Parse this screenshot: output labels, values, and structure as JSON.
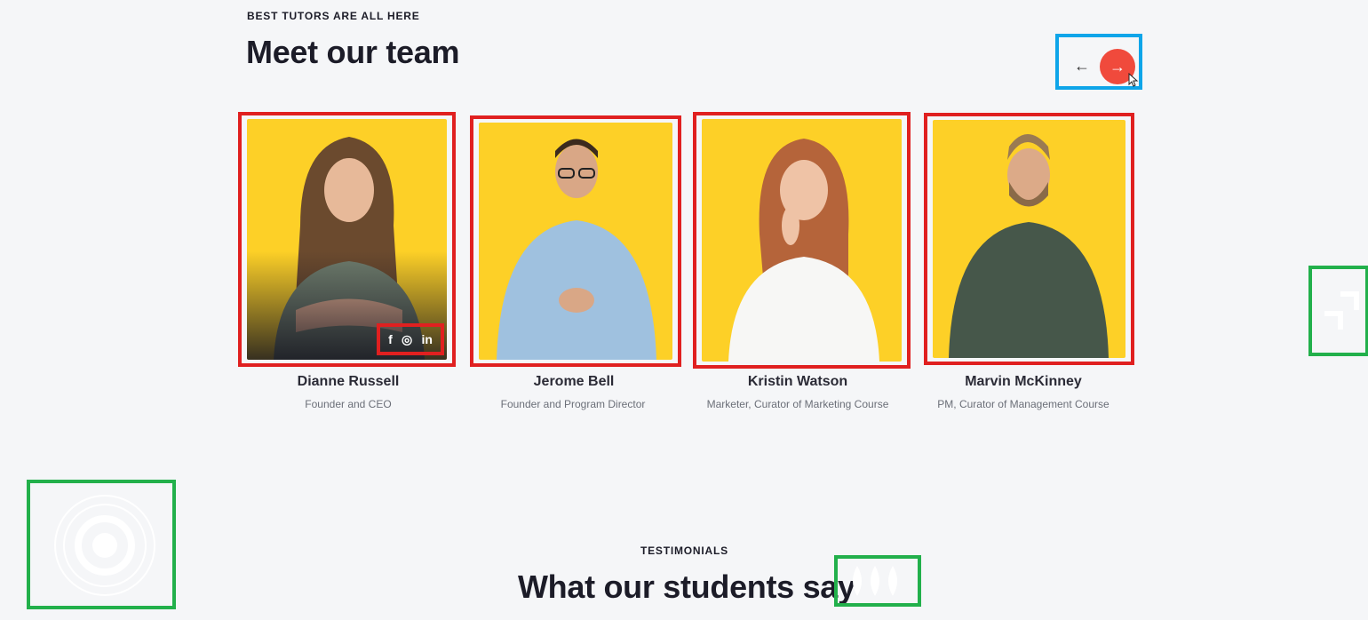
{
  "team": {
    "eyebrow": "BEST TUTORS ARE ALL HERE",
    "title": "Meet our team",
    "prev_icon": "←",
    "next_icon": "→",
    "members": [
      {
        "name": "Dianne Russell",
        "role": "Founder and CEO"
      },
      {
        "name": "Jerome Bell",
        "role": "Founder and Program Director"
      },
      {
        "name": "Kristin Watson",
        "role": "Marketer, Curator of Marketing Course"
      },
      {
        "name": "Marvin McKinney",
        "role": "PM, Curator of Management Course"
      }
    ],
    "social": {
      "facebook": "f",
      "instagram": "◎",
      "linkedin": "in"
    }
  },
  "testimonials": {
    "eyebrow": "TESTIMONIALS",
    "title": "What our students say"
  },
  "colors": {
    "accent": "#f04a3c",
    "photo_bg": "#fdd027",
    "highlight_red": "#e02020",
    "highlight_blue": "#0ea5e9",
    "highlight_green": "#22b04b"
  }
}
